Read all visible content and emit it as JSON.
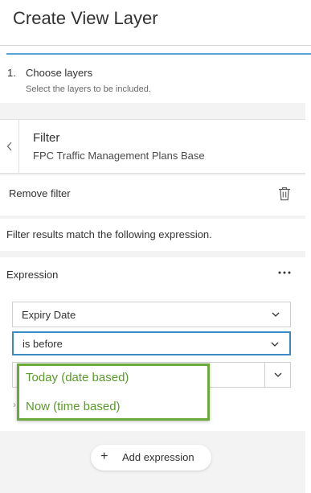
{
  "header": {
    "title": "Create View Layer"
  },
  "step": {
    "number": "1.",
    "label": "Choose layers",
    "description": "Select the layers to be included."
  },
  "filter": {
    "back_icon": "chevron-left-icon",
    "title": "Filter",
    "layer_name": "FPC Traffic Management Plans Base"
  },
  "remove": {
    "label": "Remove filter",
    "icon": "trash-icon"
  },
  "match_text": "Filter results match the following expression.",
  "expression": {
    "title": "Expression",
    "more_icon": "more-horizontal-icon",
    "field_value": "Expiry Date",
    "operator_value": "is before",
    "value_value": "",
    "stub_text": "›"
  },
  "dropdown": {
    "options": [
      "Today (date based)",
      "Now (time based)"
    ],
    "highlight_color": "#6aaa3a"
  },
  "add_expression": {
    "icon": "plus-icon",
    "label": "Add expression"
  },
  "colors": {
    "accent": "#5aa3d8",
    "focus": "#3a8ac4",
    "option_text": "#5a9a2a"
  }
}
